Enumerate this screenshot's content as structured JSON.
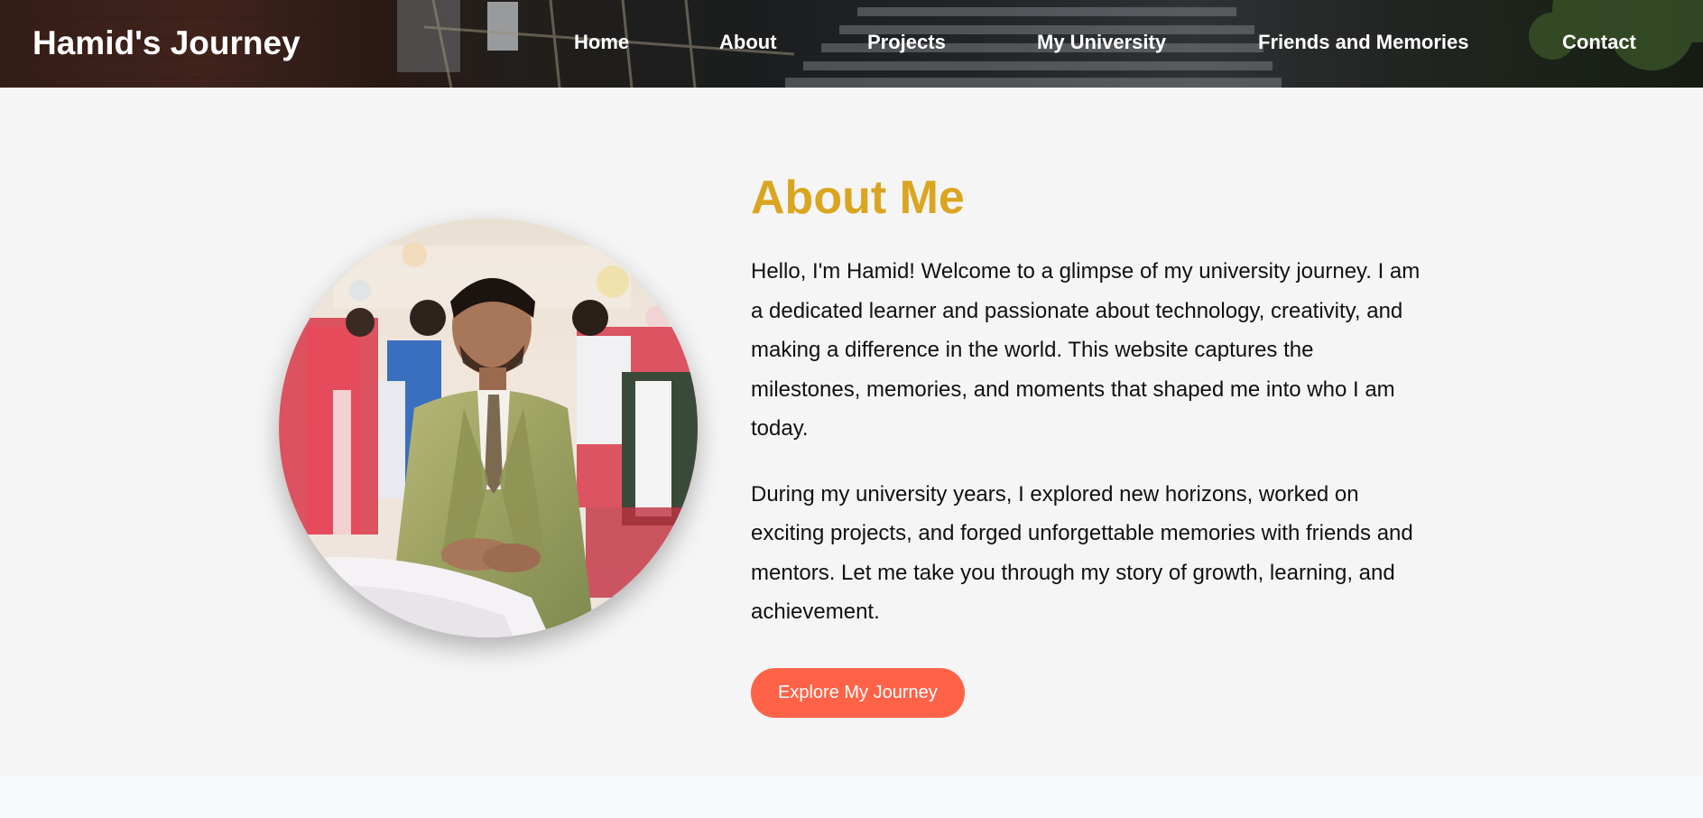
{
  "header": {
    "brand": "Hamid's Journey",
    "nav": [
      {
        "label": "Home",
        "name": "nav-home"
      },
      {
        "label": "About",
        "name": "nav-about"
      },
      {
        "label": "Projects",
        "name": "nav-projects"
      },
      {
        "label": "My University",
        "name": "nav-my-university"
      },
      {
        "label": "Friends and Memories",
        "name": "nav-friends-and-memories"
      },
      {
        "label": "Contact",
        "name": "nav-contact"
      }
    ]
  },
  "about": {
    "title": "About Me",
    "paragraphs": [
      "Hello, I'm Hamid! Welcome to a glimpse of my university journey. I am a dedicated learner and passionate about technology, creativity, and making a difference in the world. This website captures the milestones, memories, and moments that shaped me into who I am today.",
      "During my university years, I explored new horizons, worked on exciting projects, and forged unforgettable memories with friends and mentors. Let me take you through my story of growth, learning, and achievement."
    ],
    "cta_label": "Explore My Journey"
  },
  "colors": {
    "accent_title": "#daa520",
    "cta_background": "#ff6347",
    "page_background": "#f5f5f5"
  }
}
